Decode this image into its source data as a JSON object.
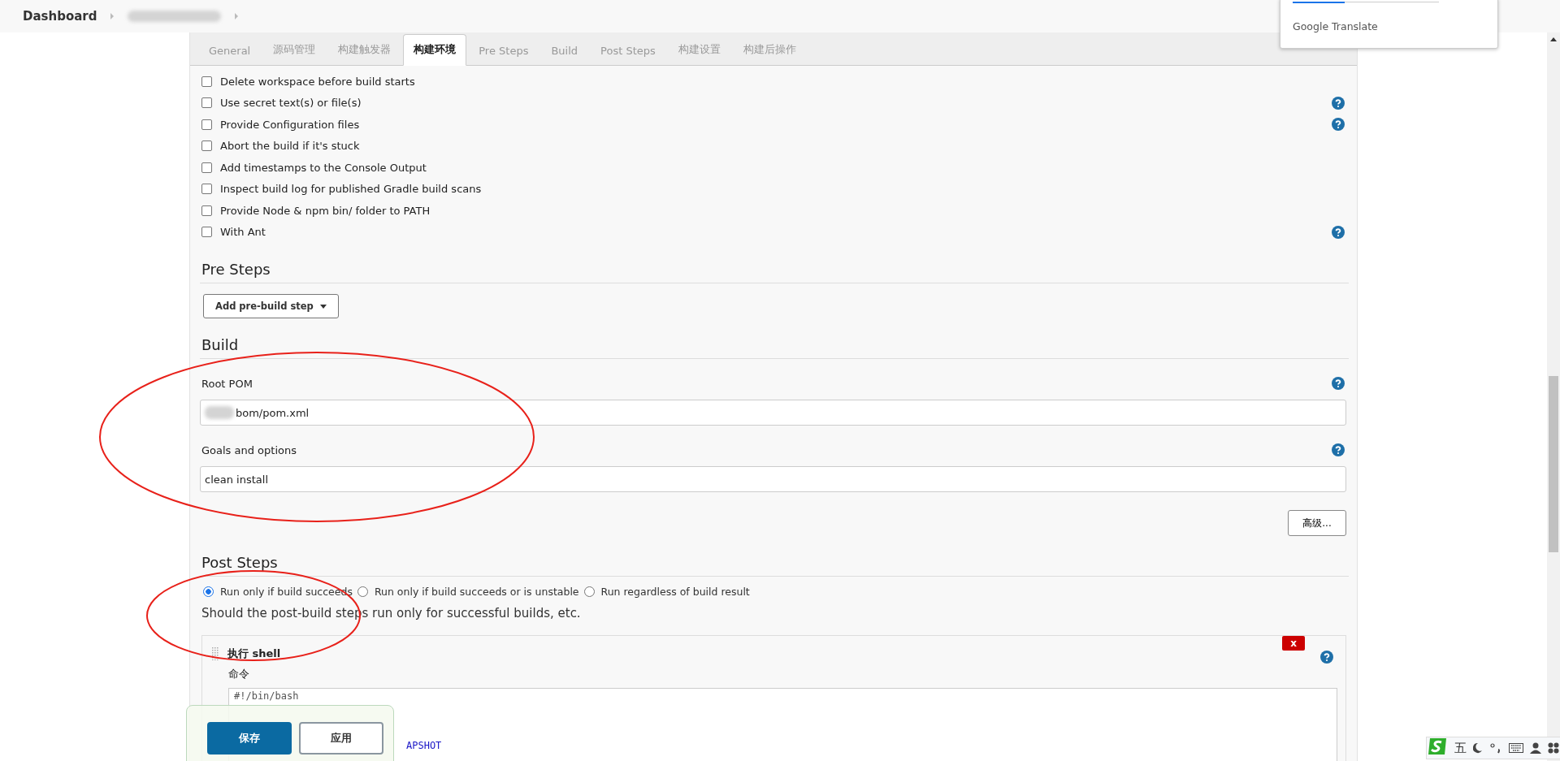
{
  "breadcrumb": {
    "title": "Dashboard"
  },
  "tabs": [
    {
      "label": "General",
      "selected": false
    },
    {
      "label": "源码管理",
      "selected": false
    },
    {
      "label": "构建触发器",
      "selected": false
    },
    {
      "label": "构建环境",
      "selected": true
    },
    {
      "label": "Pre Steps",
      "selected": false
    },
    {
      "label": "Build",
      "selected": false
    },
    {
      "label": "Post Steps",
      "selected": false
    },
    {
      "label": "构建设置",
      "selected": false
    },
    {
      "label": "构建后操作",
      "selected": false
    }
  ],
  "build_environment": {
    "options": [
      {
        "label": "Delete workspace before build starts",
        "checked": false,
        "help": false
      },
      {
        "label": "Use secret text(s) or file(s)",
        "checked": false,
        "help": true
      },
      {
        "label": "Provide Configuration files",
        "checked": false,
        "help": true
      },
      {
        "label": "Abort the build if it's stuck",
        "checked": false,
        "help": false
      },
      {
        "label": "Add timestamps to the Console Output",
        "checked": false,
        "help": false
      },
      {
        "label": "Inspect build log for published Gradle build scans",
        "checked": false,
        "help": false
      },
      {
        "label": "Provide Node & npm bin/ folder to PATH",
        "checked": false,
        "help": false
      },
      {
        "label": "With Ant",
        "checked": false,
        "help": true
      }
    ]
  },
  "pre_steps": {
    "heading": "Pre Steps",
    "add_button": "Add pre-build step"
  },
  "build": {
    "heading": "Build",
    "fields": [
      {
        "label": "Root POM",
        "value": "bom/pom.xml",
        "redacted_prefix": true
      },
      {
        "label": "Goals and options",
        "value": "clean install",
        "redacted_prefix": false
      }
    ],
    "advanced_button": "高级..."
  },
  "post_steps": {
    "heading": "Post Steps",
    "options": [
      {
        "label": "Run only if build succeeds",
        "selected": true
      },
      {
        "label": "Run only if build succeeds or is unstable",
        "selected": false
      },
      {
        "label": "Run regardless of build result",
        "selected": false
      }
    ],
    "description": "Should the post-build steps run only for successful builds, etc."
  },
  "shell_step": {
    "title": "执行 shell",
    "delete_button": "x",
    "command_label": "命令",
    "code_lines": [
      {
        "text": "#!/bin/bash",
        "kind": "comment"
      },
      {
        "text": "APSHOT",
        "kind": "partial"
      }
    ]
  },
  "action_bar": {
    "buttons": [
      {
        "label": "保存",
        "kind": "primary"
      },
      {
        "label": "应用",
        "kind": "secondary"
      }
    ]
  },
  "translate_popup": {
    "title": "Google Translate"
  },
  "ime_toolbar": {
    "mode": "五"
  }
}
